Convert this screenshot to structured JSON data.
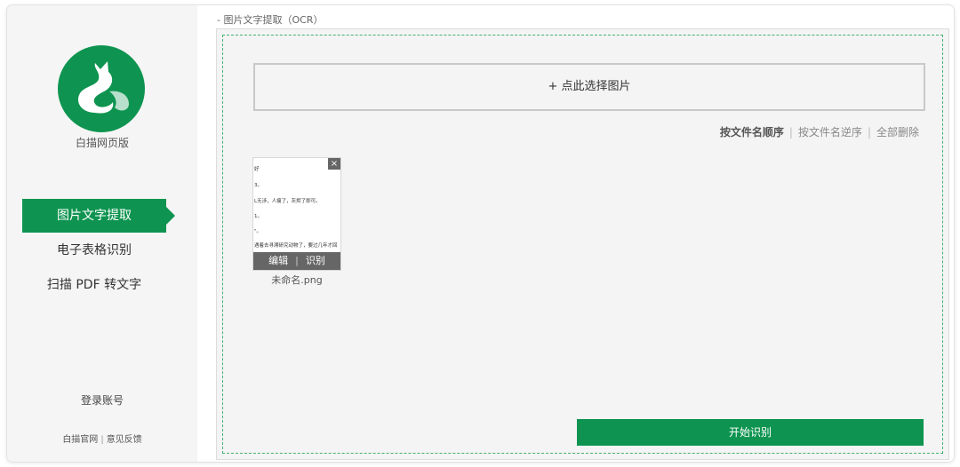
{
  "sidebar": {
    "brand": "白描网页版",
    "items": [
      {
        "label": "图片文字提取",
        "active": true
      },
      {
        "label": "电子表格识别",
        "active": false
      },
      {
        "label": "扫描 PDF 转文字",
        "active": false
      }
    ],
    "login_label": "登录账号",
    "footer": {
      "official_site": "白描官网",
      "separator": "|",
      "feedback": "意见反馈"
    }
  },
  "main": {
    "breadcrumb": "- 图片文字提取（OCR）",
    "select_button": "+ 点此选择图片",
    "sort": {
      "by_name_asc": "按文件名顺序",
      "by_name_desc": "按文件名逆序",
      "delete_all": "全部删除",
      "separator": "|"
    },
    "files": [
      {
        "name": "未命名.png",
        "preview_lines": [
          "好",
          "3。",
          "L无涉，人瘦了，灰烬了即可。",
          "1。",
          "\"。",
          "遇着去寻溯研究动物了，要过几年才回"
        ],
        "edit_label": "编辑",
        "recognize_label": "识别",
        "separator": "|",
        "close_icon": "×"
      }
    ],
    "start_button": "开始识别"
  },
  "colors": {
    "accent": "#0e9450",
    "dash_border": "#44b070"
  }
}
